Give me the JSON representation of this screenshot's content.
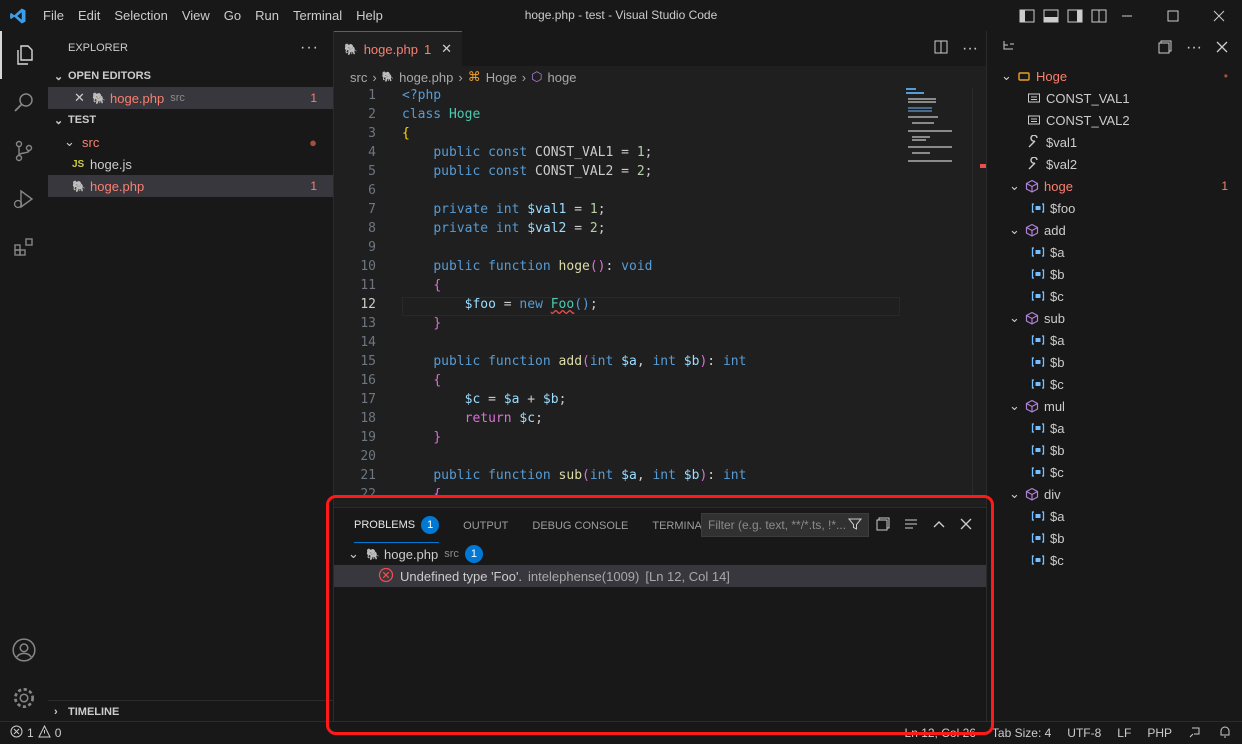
{
  "window": {
    "title": "hoge.php - test - Visual Studio Code"
  },
  "menu": [
    "File",
    "Edit",
    "Selection",
    "View",
    "Go",
    "Run",
    "Terminal",
    "Help"
  ],
  "explorer": {
    "title": "EXPLORER",
    "open_editors_label": "OPEN EDITORS",
    "open_editor": {
      "name": "hoge.php",
      "dir": "src",
      "problems": "1"
    },
    "folder_label": "TEST",
    "src_folder": "src",
    "files": [
      {
        "name": "hoge.js",
        "icon": "JS",
        "problems": ""
      },
      {
        "name": "hoge.php",
        "icon": "php",
        "problems": "1"
      }
    ],
    "timeline_label": "TIMELINE"
  },
  "tab": {
    "name": "hoge.php",
    "count": "1"
  },
  "breadcrumb": [
    "src",
    "hoge.php",
    "Hoge",
    "hoge"
  ],
  "code": {
    "current_line": 12,
    "lines": [
      {
        "n": "1",
        "html": "<span class='pr'>&lt;?php</span>"
      },
      {
        "n": "2",
        "html": "<span class='kw'>class</span> <span class='cls'>Hoge</span>"
      },
      {
        "n": "3",
        "html": "<span class='br'>{</span>"
      },
      {
        "n": "4",
        "html": "    <span class='kw'>public const</span> CONST_VAL1 = <span class='num'>1</span>;"
      },
      {
        "n": "5",
        "html": "    <span class='kw'>public const</span> CONST_VAL2 = <span class='num'>2</span>;"
      },
      {
        "n": "6",
        "html": ""
      },
      {
        "n": "7",
        "html": "    <span class='kw'>private int</span> <span class='var'>$val1</span> = <span class='num'>1</span>;"
      },
      {
        "n": "8",
        "html": "    <span class='kw'>private int</span> <span class='var'>$val2</span> = <span class='num'>2</span>;"
      },
      {
        "n": "9",
        "html": ""
      },
      {
        "n": "10",
        "html": "    <span class='kw'>public function</span> <span class='fn'>hoge</span><span class='br2'>()</span>: <span class='kw'>void</span>"
      },
      {
        "n": "11",
        "html": "    <span class='br2'>{</span>"
      },
      {
        "n": "12",
        "html": "        <span class='var'>$foo</span> = <span class='kw'>new</span> <span class='cls squig'>Foo</span><span class='kw'>()</span>;"
      },
      {
        "n": "13",
        "html": "    <span class='br2'>}</span>"
      },
      {
        "n": "14",
        "html": ""
      },
      {
        "n": "15",
        "html": "    <span class='kw'>public function</span> <span class='fn'>add</span><span class='br2'>(</span><span class='kw'>int</span> <span class='var'>$a</span>, <span class='kw'>int</span> <span class='var'>$b</span><span class='br2'>)</span>: <span class='kw'>int</span>"
      },
      {
        "n": "16",
        "html": "    <span class='br2'>{</span>"
      },
      {
        "n": "17",
        "html": "        <span class='var'>$c</span> = <span class='var'>$a</span> + <span class='var'>$b</span>;"
      },
      {
        "n": "18",
        "html": "        <span class='br2'>return</span> <span class='var'>$c</span>;"
      },
      {
        "n": "19",
        "html": "    <span class='br2'>}</span>"
      },
      {
        "n": "20",
        "html": ""
      },
      {
        "n": "21",
        "html": "    <span class='kw'>public function</span> <span class='fn'>sub</span><span class='br2'>(</span><span class='kw'>int</span> <span class='var'>$a</span>, <span class='kw'>int</span> <span class='var'>$b</span><span class='br2'>)</span>: <span class='kw'>int</span>"
      },
      {
        "n": "22",
        "html": "    <span class='br2'>{</span>"
      }
    ]
  },
  "panel": {
    "tabs": [
      {
        "label": "PROBLEMS",
        "badge": "1"
      },
      {
        "label": "OUTPUT",
        "badge": ""
      },
      {
        "label": "DEBUG CONSOLE",
        "badge": ""
      },
      {
        "label": "TERMINAL",
        "badge": ""
      }
    ],
    "filter_placeholder": "Filter (e.g. text, **/*.ts, !*...",
    "file": {
      "name": "hoge.php",
      "dir": "src",
      "count": "1"
    },
    "problem": {
      "message": "Undefined type 'Foo'.",
      "source": "intelephense(1009)",
      "location": "[Ln 12, Col 14]"
    }
  },
  "outline": {
    "items": [
      {
        "label": "Hoge",
        "kind": "class",
        "depth": 0,
        "problems": "•"
      },
      {
        "label": "CONST_VAL1",
        "kind": "const",
        "depth": 1,
        "problems": ""
      },
      {
        "label": "CONST_VAL2",
        "kind": "const",
        "depth": 1,
        "problems": ""
      },
      {
        "label": "$val1",
        "kind": "prop",
        "depth": 1,
        "problems": ""
      },
      {
        "label": "$val2",
        "kind": "prop",
        "depth": 1,
        "problems": ""
      },
      {
        "label": "hoge",
        "kind": "method",
        "depth": 1,
        "problems": "1"
      },
      {
        "label": "$foo",
        "kind": "var",
        "depth": 2,
        "problems": ""
      },
      {
        "label": "add",
        "kind": "method",
        "depth": 1,
        "problems": ""
      },
      {
        "label": "$a",
        "kind": "var",
        "depth": 2,
        "problems": ""
      },
      {
        "label": "$b",
        "kind": "var",
        "depth": 2,
        "problems": ""
      },
      {
        "label": "$c",
        "kind": "var",
        "depth": 2,
        "problems": ""
      },
      {
        "label": "sub",
        "kind": "method",
        "depth": 1,
        "problems": ""
      },
      {
        "label": "$a",
        "kind": "var",
        "depth": 2,
        "problems": ""
      },
      {
        "label": "$b",
        "kind": "var",
        "depth": 2,
        "problems": ""
      },
      {
        "label": "$c",
        "kind": "var",
        "depth": 2,
        "problems": ""
      },
      {
        "label": "mul",
        "kind": "method",
        "depth": 1,
        "problems": ""
      },
      {
        "label": "$a",
        "kind": "var",
        "depth": 2,
        "problems": ""
      },
      {
        "label": "$b",
        "kind": "var",
        "depth": 2,
        "problems": ""
      },
      {
        "label": "$c",
        "kind": "var",
        "depth": 2,
        "problems": ""
      },
      {
        "label": "div",
        "kind": "method",
        "depth": 1,
        "problems": ""
      },
      {
        "label": "$a",
        "kind": "var",
        "depth": 2,
        "problems": ""
      },
      {
        "label": "$b",
        "kind": "var",
        "depth": 2,
        "problems": ""
      },
      {
        "label": "$c",
        "kind": "var",
        "depth": 2,
        "problems": ""
      }
    ]
  },
  "status": {
    "errors": "1",
    "warnings": "0",
    "position": "Ln 12, Col 26",
    "tab_size": "Tab Size: 4",
    "encoding": "UTF-8",
    "eol": "LF",
    "language": "PHP"
  },
  "colors": {
    "accent": "#0078d4",
    "error": "#f14c4c",
    "annotation": "#ff1a1a"
  }
}
